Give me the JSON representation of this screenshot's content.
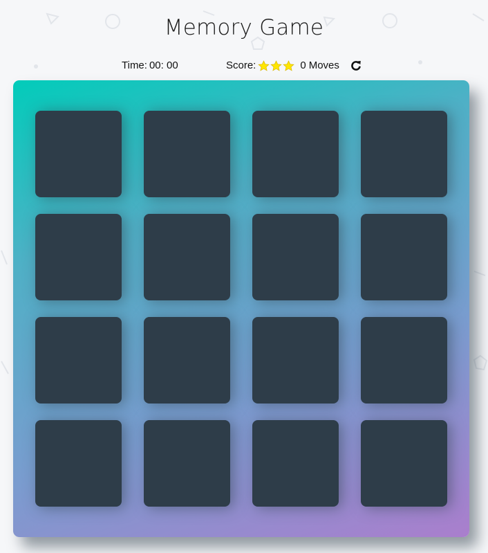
{
  "header": {
    "title": "Memory Game"
  },
  "score_panel": {
    "time_label": "Time:",
    "time_value": "00: 00",
    "score_label": "Score:",
    "stars": [
      {
        "icon": "star-icon",
        "color": "#ffe600",
        "filled": true
      },
      {
        "icon": "star-icon",
        "color": "#ffe600",
        "filled": true
      },
      {
        "icon": "star-icon",
        "color": "#ffe600",
        "filled": true
      }
    ],
    "stars_count": 3,
    "moves_count": "0",
    "moves_label": "Moves",
    "restart_icon": "restart-icon"
  },
  "deck": {
    "rows": 4,
    "columns": 4,
    "card_count": 16,
    "card_state": "face-down",
    "gradient": {
      "start": "#02ccba",
      "end": "#aa7ecd"
    },
    "card_color": "#2e3d49"
  },
  "background": {
    "color": "#f6f7f9",
    "shape_color": "#e2e5ea"
  }
}
